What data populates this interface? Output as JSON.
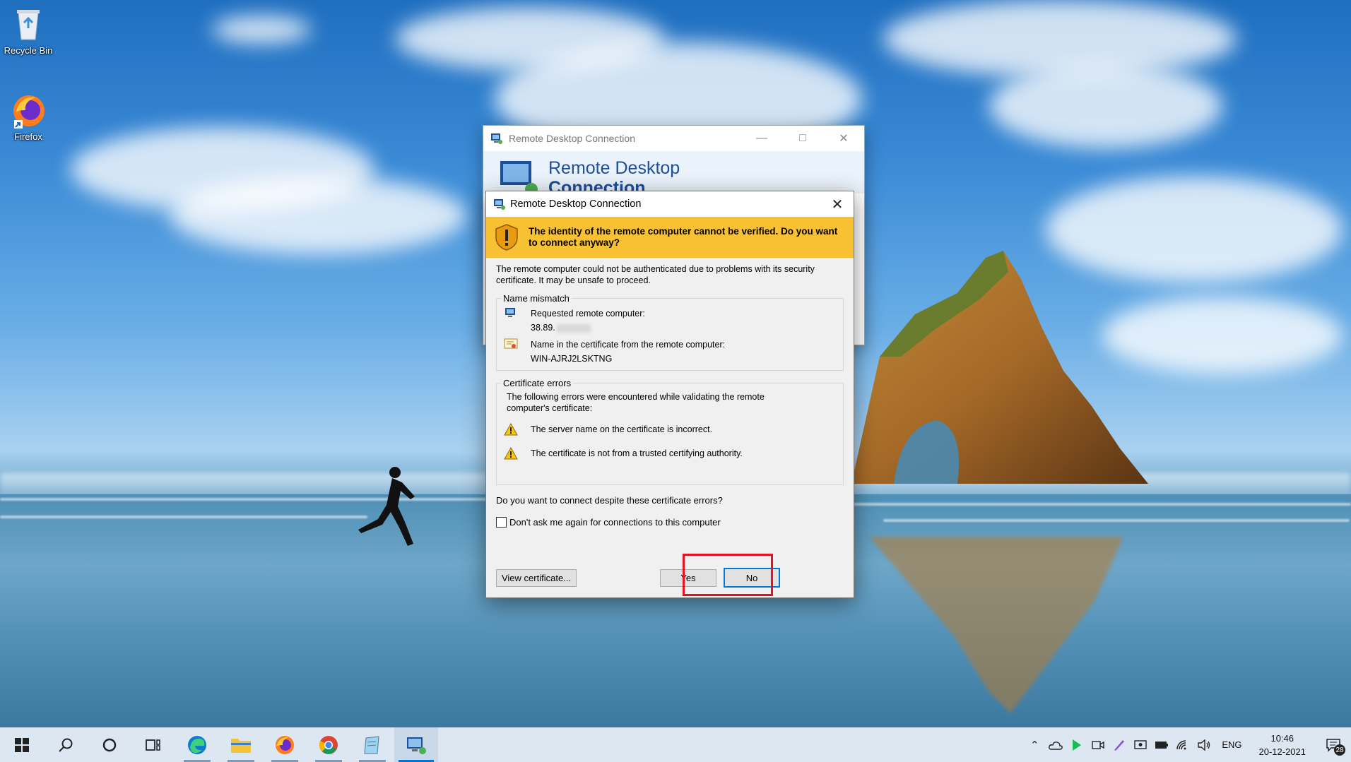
{
  "desktop": {
    "icons": [
      {
        "label": "Recycle Bin",
        "icon": "recycle-bin-icon"
      },
      {
        "label": "Firefox",
        "icon": "firefox-icon"
      }
    ]
  },
  "parent_window": {
    "title": "Remote Desktop Connection",
    "banner_title_line1": "Remote Desktop",
    "banner_title_line2": "Connection"
  },
  "dialog": {
    "title": "Remote Desktop Connection",
    "warning_heading": "The identity of the remote computer cannot be verified. Do you want to connect anyway?",
    "intro": "The remote computer could not be authenticated due to problems with its security certificate. It may be unsafe to proceed.",
    "name_mismatch": {
      "legend": "Name mismatch",
      "requested_label": "Requested remote computer:",
      "requested_value": "38.89.",
      "cert_name_label": "Name in the certificate from the remote computer:",
      "cert_name_value": "WIN-AJRJ2LSKTNG"
    },
    "certificate_errors": {
      "legend": "Certificate errors",
      "intro": "The following errors were encountered while validating the remote computer's certificate:",
      "errors": [
        "The server name on the certificate is incorrect.",
        "The certificate is not from a trusted certifying authority."
      ]
    },
    "question": "Do you want to connect despite these certificate errors?",
    "dont_ask_label": "Don't ask me again for connections to this computer",
    "dont_ask_checked": false,
    "buttons": {
      "view_certificate": "View certificate...",
      "yes": "Yes",
      "no": "No"
    },
    "highlight_color": "#e81123"
  },
  "taskbar": {
    "pinned": [
      "windows-start-icon",
      "search-icon",
      "cortana-icon",
      "task-view-icon",
      "edge-icon",
      "file-explorer-icon",
      "firefox-icon",
      "chrome-icon",
      "notepad-icon",
      "remote-desktop-icon"
    ],
    "language": "ENG",
    "time": "10:46",
    "date": "20-12-2021",
    "notification_count": "28",
    "accent": "#0078d7"
  }
}
